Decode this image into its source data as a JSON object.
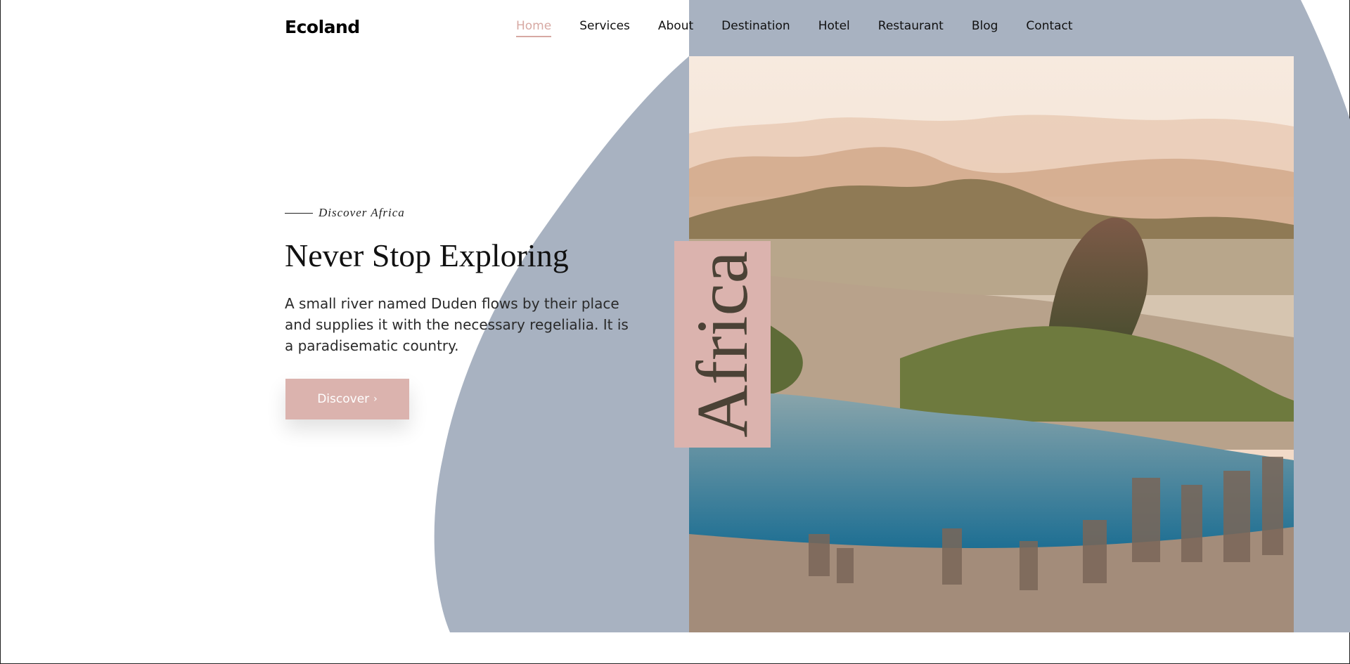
{
  "brand": {
    "logo_text": "Ecoland"
  },
  "nav": {
    "items": [
      {
        "label": "Home",
        "active": true
      },
      {
        "label": "Services"
      },
      {
        "label": "About"
      },
      {
        "label": "Destination"
      },
      {
        "label": "Hotel"
      },
      {
        "label": "Restaurant"
      },
      {
        "label": "Blog"
      },
      {
        "label": "Contact"
      }
    ]
  },
  "hero": {
    "eyebrow": "Discover Africa",
    "headline": "Never Stop Exploring",
    "body": "A small river named Duden flows by their place and supplies it with the necessary regelialia. It is a paradisematic country.",
    "cta_label": "Discover",
    "cta_icon": "chevron-right-icon",
    "tag_label": "Africa"
  },
  "colors": {
    "accent": "#dbb3ae",
    "nav_active": "#d7a9a3",
    "blob": "#a8b2c1"
  }
}
